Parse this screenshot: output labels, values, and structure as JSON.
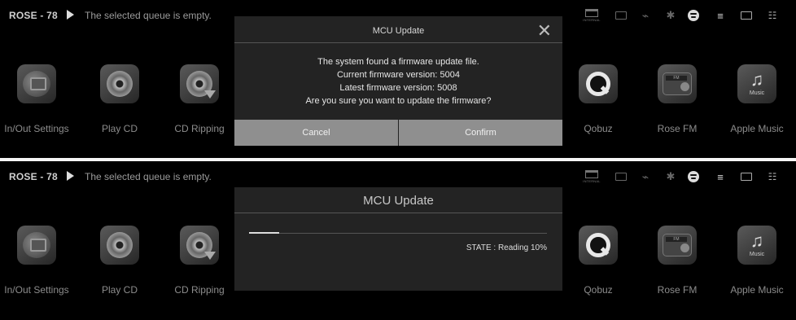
{
  "device_name": "ROSE - 78",
  "queue_text": "The selected queue is empty.",
  "status_bar": {
    "internal_label": "INTERNAL",
    "icons": [
      "internal-storage-icon",
      "mail-icon",
      "bike-icon",
      "bluetooth-icon",
      "spotify-icon",
      "equalizer-icon",
      "cast-icon",
      "network-icon"
    ]
  },
  "apps": [
    {
      "label": "In/Out Settings",
      "icon": "in-out-settings-icon"
    },
    {
      "label": "Play CD",
      "icon": "cd-icon"
    },
    {
      "label": "CD Ripping",
      "icon": "cd-ripping-icon"
    },
    {
      "label": "Qobuz",
      "icon": "qobuz-icon"
    },
    {
      "label": "Rose FM",
      "icon": "radio-icon"
    },
    {
      "label": "Apple Music",
      "icon": "apple-music-icon"
    }
  ],
  "apple_music_badge": "Music",
  "fm_screen_text": "FM",
  "confirm_dialog": {
    "title": "MCU Update",
    "lines": [
      "The system found a firmware update file.",
      "Current firmware version: 5004",
      "Latest firmware version: 5008",
      "Are you sure you want to update the firmware?"
    ],
    "cancel_label": "Cancel",
    "confirm_label": "Confirm"
  },
  "progress_dialog": {
    "title": "MCU Update",
    "state_text": "STATE : Reading 10%",
    "progress_fraction": 0.1
  }
}
